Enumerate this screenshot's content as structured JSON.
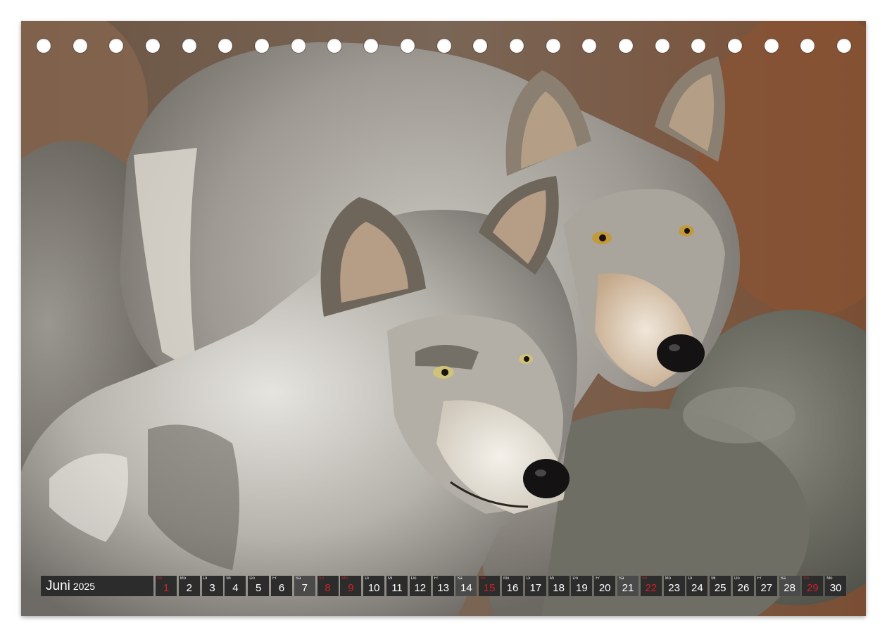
{
  "calendar": {
    "month": "Juni",
    "year": "2025",
    "days": [
      {
        "wd": "So",
        "d": "1",
        "type": "sunday"
      },
      {
        "wd": "Mo",
        "d": "2",
        "type": "week"
      },
      {
        "wd": "Di",
        "d": "3",
        "type": "week"
      },
      {
        "wd": "Mi",
        "d": "4",
        "type": "week"
      },
      {
        "wd": "Do",
        "d": "5",
        "type": "week"
      },
      {
        "wd": "Fr",
        "d": "6",
        "type": "week"
      },
      {
        "wd": "Sa",
        "d": "7",
        "type": "saturday"
      },
      {
        "wd": "So",
        "d": "8",
        "type": "sunday"
      },
      {
        "wd": "Mo",
        "d": "9",
        "type": "holiday"
      },
      {
        "wd": "Di",
        "d": "10",
        "type": "week"
      },
      {
        "wd": "Mi",
        "d": "11",
        "type": "week"
      },
      {
        "wd": "Do",
        "d": "12",
        "type": "week"
      },
      {
        "wd": "Fr",
        "d": "13",
        "type": "week"
      },
      {
        "wd": "Sa",
        "d": "14",
        "type": "saturday"
      },
      {
        "wd": "So",
        "d": "15",
        "type": "sunday"
      },
      {
        "wd": "Mo",
        "d": "16",
        "type": "week"
      },
      {
        "wd": "Di",
        "d": "17",
        "type": "week"
      },
      {
        "wd": "Mi",
        "d": "18",
        "type": "week"
      },
      {
        "wd": "Do",
        "d": "19",
        "type": "week"
      },
      {
        "wd": "Fr",
        "d": "20",
        "type": "week"
      },
      {
        "wd": "Sa",
        "d": "21",
        "type": "saturday"
      },
      {
        "wd": "So",
        "d": "22",
        "type": "sunday"
      },
      {
        "wd": "Mo",
        "d": "23",
        "type": "week"
      },
      {
        "wd": "Di",
        "d": "24",
        "type": "week"
      },
      {
        "wd": "Mi",
        "d": "25",
        "type": "week"
      },
      {
        "wd": "Do",
        "d": "26",
        "type": "week"
      },
      {
        "wd": "Fr",
        "d": "27",
        "type": "week"
      },
      {
        "wd": "Sa",
        "d": "28",
        "type": "saturday"
      },
      {
        "wd": "So",
        "d": "29",
        "type": "sunday"
      },
      {
        "wd": "Mo",
        "d": "30",
        "type": "week"
      }
    ]
  },
  "binding_holes": 23,
  "photo": {
    "icon": "two-wolves-photo"
  },
  "colors": {
    "bar": "#2c2c2c",
    "saturday_cell": "#4a4a4a",
    "sunday_text": "#d0202a",
    "weekday_text": "#ffffff"
  }
}
